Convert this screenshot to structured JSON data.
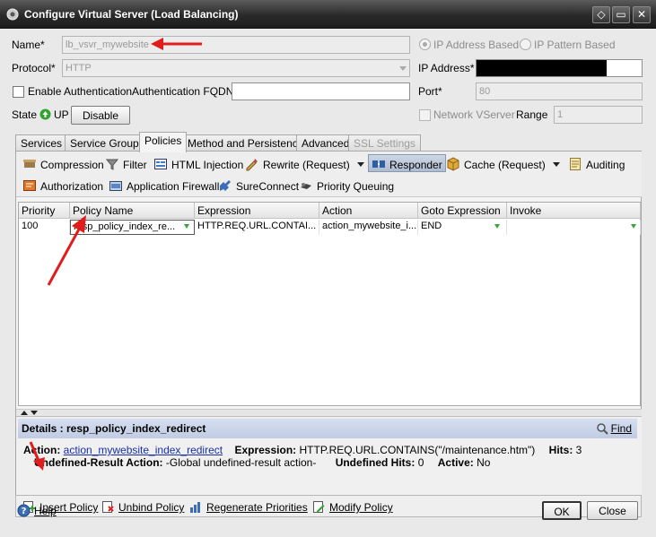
{
  "window": {
    "title": "Configure Virtual Server (Load Balancing)"
  },
  "form": {
    "name_label": "Name*",
    "name_value": "lb_vsvr_mywebsite",
    "protocol_label": "Protocol*",
    "protocol_value": "HTTP",
    "enable_auth_label": "Enable Authentication",
    "auth_fqdn_label": "Authentication FQDN",
    "state_label": "State",
    "state_value": "UP",
    "disable_button": "Disable",
    "ip_based_label": "IP Address Based",
    "ip_pattern_label": "IP Pattern Based",
    "ip_address_label": "IP Address*",
    "port_label": "Port*",
    "port_value": "80",
    "network_vserver_label": "Network VServer",
    "range_label": "Range",
    "range_value": "1"
  },
  "tabs": [
    "Services",
    "Service Groups",
    "Policies",
    "Method and Persistence",
    "Advanced",
    "SSL Settings"
  ],
  "toolbar": {
    "row1": [
      "Compression",
      "Filter",
      "HTML Injection",
      "Rewrite (Request)",
      "Responder",
      "Cache (Request)",
      "Auditing"
    ],
    "row2": [
      "Authorization",
      "Application Firewall",
      "SureConnect",
      "Priority Queuing"
    ]
  },
  "table": {
    "columns": [
      "Priority",
      "Policy Name",
      "Expression",
      "Action",
      "Goto Expression",
      "Invoke"
    ],
    "rows": [
      {
        "priority": "100",
        "policy_name": "resp_policy_index_re...",
        "expression": "HTTP.REQ.URL.CONTAI...",
        "action": "action_mywebsite_i...",
        "goto": "END",
        "invoke": ""
      }
    ]
  },
  "details": {
    "header": "Details : resp_policy_index_redirect",
    "find": "Find",
    "action_label": "Action:",
    "action_value": "action_mywebsite_index_redirect",
    "expression_label": "Expression:",
    "expression_value": "HTTP.REQ.URL.CONTAINS(\"/maintenance.htm\")",
    "hits_label": "Hits:",
    "hits_value": "3",
    "undef_action_label": "Undefined-Result Action:",
    "undef_action_value": "-Global undefined-result action-",
    "undef_hits_label": "Undefined Hits:",
    "undef_hits_value": "0",
    "active_label": "Active:",
    "active_value": "No"
  },
  "policy_actions": [
    "Insert Policy",
    "Unbind Policy",
    "Regenerate Priorities",
    "Modify Policy"
  ],
  "footer": {
    "help": "Help",
    "ok": "OK",
    "close": "Close"
  },
  "colors": {
    "annotation_arrow": "#e01c1c",
    "status_up": "#2fa52f",
    "link": "#1a2fa8"
  }
}
